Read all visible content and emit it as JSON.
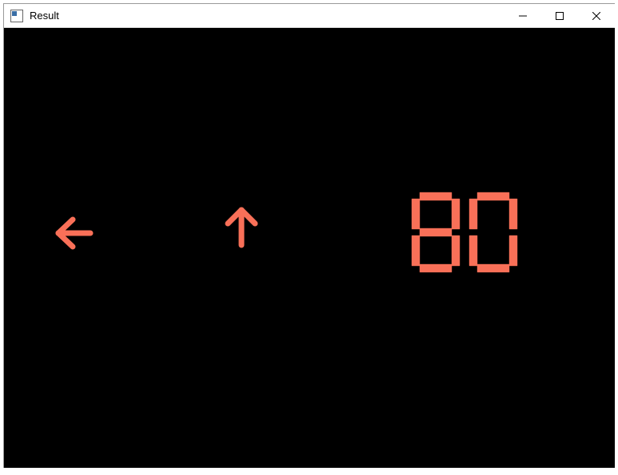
{
  "window": {
    "title": "Result"
  },
  "display": {
    "left_arrow": "arrow-left",
    "up_arrow": "arrow-up",
    "value": "80",
    "color": "#f97058"
  }
}
